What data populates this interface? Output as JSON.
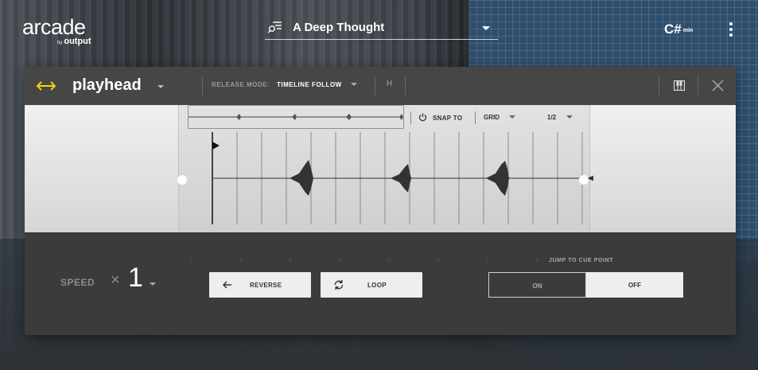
{
  "app": {
    "logo_main": "arcade",
    "logo_by": "by",
    "logo_brand": "output"
  },
  "preset": {
    "name": "A Deep Thought"
  },
  "key": {
    "note": "C#",
    "mode": "min"
  },
  "panel": {
    "title": "playhead",
    "release_mode_label": "RELEASE MODE:",
    "release_mode_value": "TIMELINE FOLLOW",
    "h_label": "H"
  },
  "waveform": {
    "snap_label": "SNAP TO",
    "grid_label": "GRID",
    "division": "1/2",
    "beat_labels": [
      "1",
      "2",
      "3",
      "4",
      "5",
      "6",
      "7",
      "8"
    ]
  },
  "controls": {
    "speed_label": "SPEED",
    "speed_prefix": "×",
    "speed_value": "1",
    "reverse_label": "REVERSE",
    "loop_label": "LOOP",
    "jump_label": "JUMP TO CUE POINT",
    "jump_on": "ON",
    "jump_off": "OFF",
    "jump_selected": "OFF"
  },
  "colors": {
    "accent_yellow": "#f5d20a",
    "panel_bg": "#3b3b3b"
  }
}
